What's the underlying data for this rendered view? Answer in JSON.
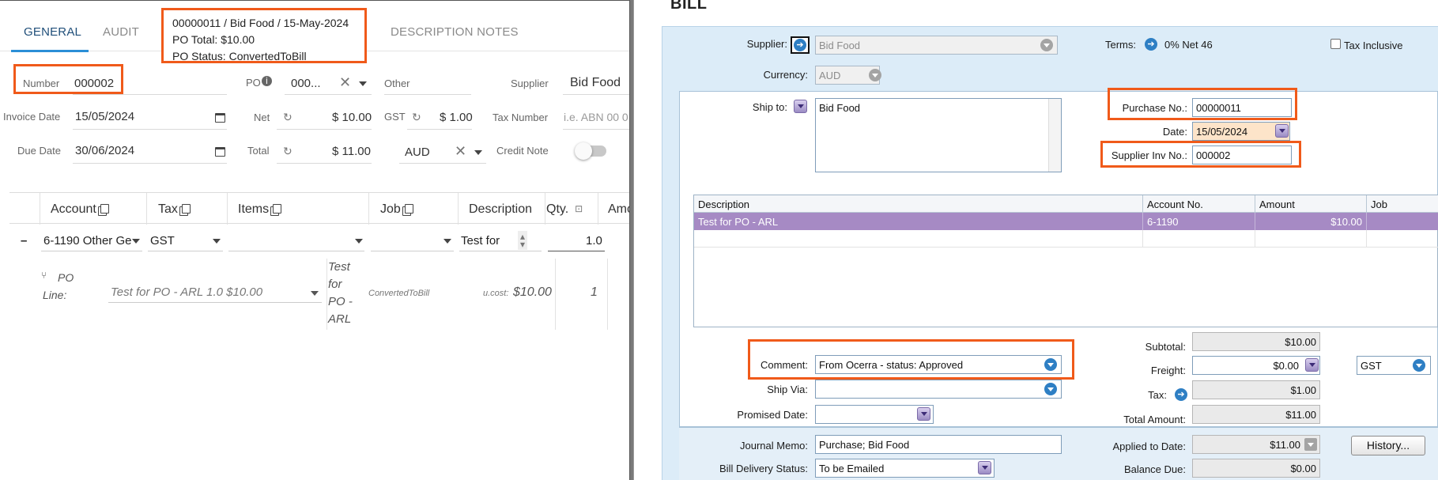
{
  "left": {
    "tabs": [
      {
        "label": "GENERAL",
        "active": true
      },
      {
        "label": "AUDIT",
        "active": false
      },
      {
        "label": "DESCRIPTION NOTES",
        "active": false
      }
    ],
    "tooltip": {
      "line1": "00000011 / Bid Food / 15-May-2024",
      "line2": "PO Total: $10.00",
      "line3": "PO Status: ConvertedToBill"
    },
    "fields": {
      "number_label": "Number",
      "number_value": "000002",
      "po_label": "PO",
      "po_value": "000...",
      "other_label": "Other",
      "supplier_label": "Supplier",
      "supplier_value": "Bid Food",
      "invoice_date_label": "Invoice Date",
      "invoice_date_value": "15/05/2024",
      "net_label": "Net",
      "net_value": "$ 10.00",
      "gst_label": "GST",
      "gst_value": "$ 1.00",
      "tax_number_label": "Tax Number",
      "tax_number_placeholder": "i.e. ABN 00 0",
      "due_date_label": "Due Date",
      "due_date_value": "30/06/2024",
      "total_label": "Total",
      "total_value": "$ 11.00",
      "currency_value": "AUD",
      "credit_note_label": "Credit Note"
    },
    "grid": {
      "headers": [
        "Account",
        "Tax",
        "Items",
        "Job",
        "Description",
        "Qty.",
        "Amo"
      ],
      "row": {
        "collapse": "–",
        "account": "6-1190 Other Ge",
        "tax": "GST",
        "items": "",
        "job": "",
        "description": "Test for",
        "qty": "1.0"
      }
    },
    "po_line": {
      "label_line1": "PO",
      "label_line2": "Line:",
      "selection": "Test for PO - ARL 1.0 $10.00",
      "desc_lines": [
        "Test",
        "for",
        "PO -",
        "ARL"
      ],
      "status": "ConvertedToBill",
      "ucost_label": "u.cost:",
      "ucost_value": "$10.00",
      "qty": "1"
    }
  },
  "right": {
    "title": "BILL",
    "supplier_label": "Supplier:",
    "supplier_value": "Bid Food",
    "terms_label": "Terms:",
    "terms_value": "0% Net 46",
    "tax_inclusive_label": "Tax Inclusive",
    "currency_label": "Currency:",
    "currency_value": "AUD",
    "ship_to_label": "Ship to:",
    "ship_to_value": "Bid Food",
    "purchase_no_label": "Purchase No.:",
    "purchase_no_value": "00000011",
    "date_label": "Date:",
    "date_value": "15/05/2024",
    "supplier_inv_label": "Supplier Inv No.:",
    "supplier_inv_value": "000002",
    "table": {
      "headers": [
        "Description",
        "Account No.",
        "Amount",
        "Job"
      ],
      "rows": [
        {
          "description": "Test for PO - ARL",
          "account": "6-1190",
          "amount": "$10.00",
          "job": ""
        }
      ]
    },
    "comment_label": "Comment:",
    "comment_value": "From Ocerra - status: Approved",
    "ship_via_label": "Ship Via:",
    "promised_date_label": "Promised Date:",
    "subtotal_label": "Subtotal:",
    "subtotal_value": "$10.00",
    "freight_label": "Freight:",
    "freight_value": "$0.00",
    "freight_tax": "GST",
    "tax_label": "Tax:",
    "tax_value": "$1.00",
    "total_amount_label": "Total Amount:",
    "total_amount_value": "$11.00",
    "journal_memo_label": "Journal Memo:",
    "journal_memo_value": "Purchase; Bid Food",
    "applied_label": "Applied to Date:",
    "applied_value": "$11.00",
    "history_button": "History...",
    "delivery_label": "Bill Delivery Status:",
    "delivery_value": "To be Emailed",
    "balance_label": "Balance Due:",
    "balance_value": "$0.00"
  },
  "colors": {
    "highlight": "#f05a1a",
    "accent": "#2b8fd6",
    "selected_row": "#a68ac4",
    "bill_form_bg": "#dcecf8"
  }
}
